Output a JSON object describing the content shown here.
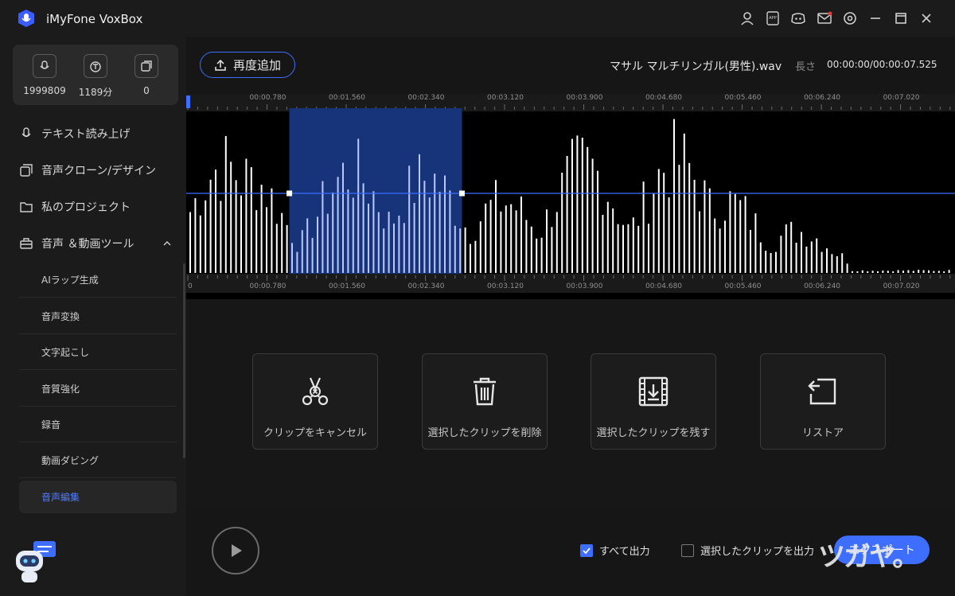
{
  "app": {
    "title": "iMyFone VoxBox"
  },
  "titlebar_icons": [
    "user-icon",
    "app-icon",
    "discord-icon",
    "mail-icon",
    "settings-icon",
    "minimize-icon",
    "maximize-icon",
    "close-icon"
  ],
  "titlebar_app_text": "APP",
  "stats": [
    {
      "icon": "voice-icon",
      "value": "1999809"
    },
    {
      "icon": "text-icon",
      "value": "1189分"
    },
    {
      "icon": "clone-icon",
      "value": "0"
    }
  ],
  "nav": [
    {
      "icon": "microphone-icon",
      "label": "テキスト読み上げ"
    },
    {
      "icon": "clone-icon",
      "label": "音声クローン/デザイン"
    },
    {
      "icon": "folder-icon",
      "label": "私のプロジェクト"
    },
    {
      "icon": "toolbox-icon",
      "label": "音声 ＆動画ツール"
    }
  ],
  "sub_nav": [
    {
      "label": "AIラップ生成",
      "active": false
    },
    {
      "label": "音声変換",
      "active": false
    },
    {
      "label": "文字起こし",
      "active": false
    },
    {
      "label": "音質強化",
      "active": false
    },
    {
      "label": "録音",
      "active": false
    },
    {
      "label": "動画ダビング",
      "active": false
    },
    {
      "label": "音声編集",
      "active": true
    }
  ],
  "toolbar": {
    "re_add_label": "再度追加",
    "file_name": "マサル マルチリンガル(男性).wav",
    "length_label": "長さ",
    "time": "00:00:00/00:00:07.525"
  },
  "ruler": {
    "top_labels": [
      "00:00.780",
      "00:01.560",
      "00:02.340",
      "00:03.120",
      "00:03.900",
      "00:04.680",
      "00:05.460",
      "00:06.240",
      "00:07.020"
    ],
    "bottom_labels": [
      "0",
      "00:00.780",
      "00:01.560",
      "00:02.340",
      "00:03.120",
      "00:03.900",
      "00:04.680",
      "00:05.460",
      "00:06.240",
      "00:07.020"
    ]
  },
  "waveform": {
    "duration_s": 7.525,
    "selection_start_s": 1.0,
    "selection_end_s": 2.7
  },
  "actions": [
    {
      "icon": "scissors-cancel-icon",
      "label": "クリップをキャンセル"
    },
    {
      "icon": "trash-icon",
      "label": "選択したクリップを削除"
    },
    {
      "icon": "film-keep-icon",
      "label": "選択したクリップを残す"
    },
    {
      "icon": "restore-icon",
      "label": "リストア"
    }
  ],
  "output": {
    "all_label": "すべて出力",
    "all_checked": true,
    "selected_label": "選択したクリップを出力",
    "selected_checked": false,
    "export_label": "エクスポート"
  },
  "watermark": "ツガヤ。",
  "colors": {
    "accent": "#3d6eff",
    "active_nav": "#4f7dff"
  }
}
